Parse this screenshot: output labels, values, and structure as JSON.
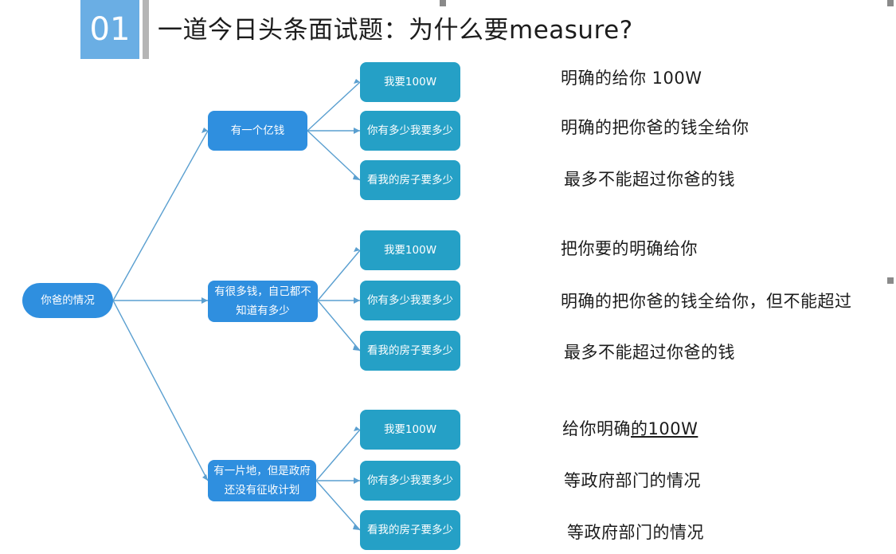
{
  "header": {
    "number": "01",
    "title": "一道今日头条面试题：为什么要measure?"
  },
  "colors": {
    "badge": "#6aaee4",
    "root_node": "#2f8fdf",
    "branch_node": "#2f8fdf",
    "leaf_node": "#25a0c6",
    "connector": "#5a9fd0"
  },
  "mindmap": {
    "root": "你爸的情况",
    "branches": [
      {
        "label": "有一个亿钱",
        "leaves": [
          "我要100W",
          "你有多少我要多少",
          "看我的房子要多少"
        ],
        "notes": [
          "明确的给你 100W",
          "明确的把你爸的钱全给你",
          "最多不能超过你爸的钱"
        ]
      },
      {
        "label": "有很多钱，自己都不知道有多少",
        "leaves": [
          "我要100W",
          "你有多少我要多少",
          "看我的房子要多少"
        ],
        "notes": [
          "把你要的明确给你",
          "明确的把你爸的钱全给你，但不能超过",
          "最多不能超过你爸的钱"
        ]
      },
      {
        "label": "有一片地，但是政府还没有征收计划",
        "leaves": [
          "我要100W",
          "你有多少我要多少",
          "看我的房子要多少"
        ],
        "notes": [
          "给你明确",
          "等政府部门的情况",
          "等政府部门的情况"
        ]
      }
    ],
    "note_emphasis": "的100W"
  }
}
